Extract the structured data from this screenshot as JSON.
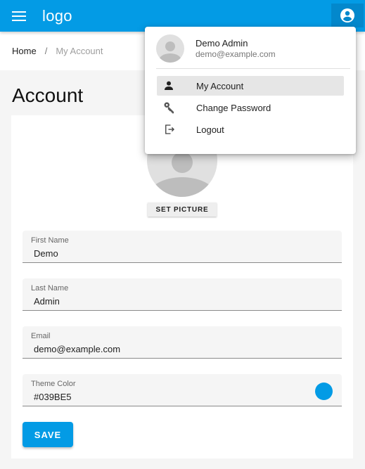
{
  "header": {
    "logo": "logo",
    "menu_icon": "menu-icon",
    "account_icon": "account-circle-icon"
  },
  "breadcrumb": {
    "home": "Home",
    "separator": "/",
    "current": "My Account"
  },
  "page": {
    "title": "Account"
  },
  "profile": {
    "set_picture_label": "SET PICTURE"
  },
  "form": {
    "first_name": {
      "label": "First Name",
      "value": "Demo"
    },
    "last_name": {
      "label": "Last Name",
      "value": "Admin"
    },
    "email": {
      "label": "Email",
      "value": "demo@example.com"
    },
    "theme_color": {
      "label": "Theme Color",
      "value": "#039BE5"
    },
    "save_label": "SAVE"
  },
  "dropdown": {
    "user_name": "Demo Admin",
    "user_email": "demo@example.com",
    "items": [
      {
        "label": "My Account",
        "icon": "person-icon",
        "active": true
      },
      {
        "label": "Change Password",
        "icon": "key-icon",
        "active": false
      },
      {
        "label": "Logout",
        "icon": "logout-icon",
        "active": false
      }
    ]
  },
  "colors": {
    "primary": "#039BE5",
    "primary_dark": "#0388CC",
    "page_bg": "#F5F5F5"
  }
}
